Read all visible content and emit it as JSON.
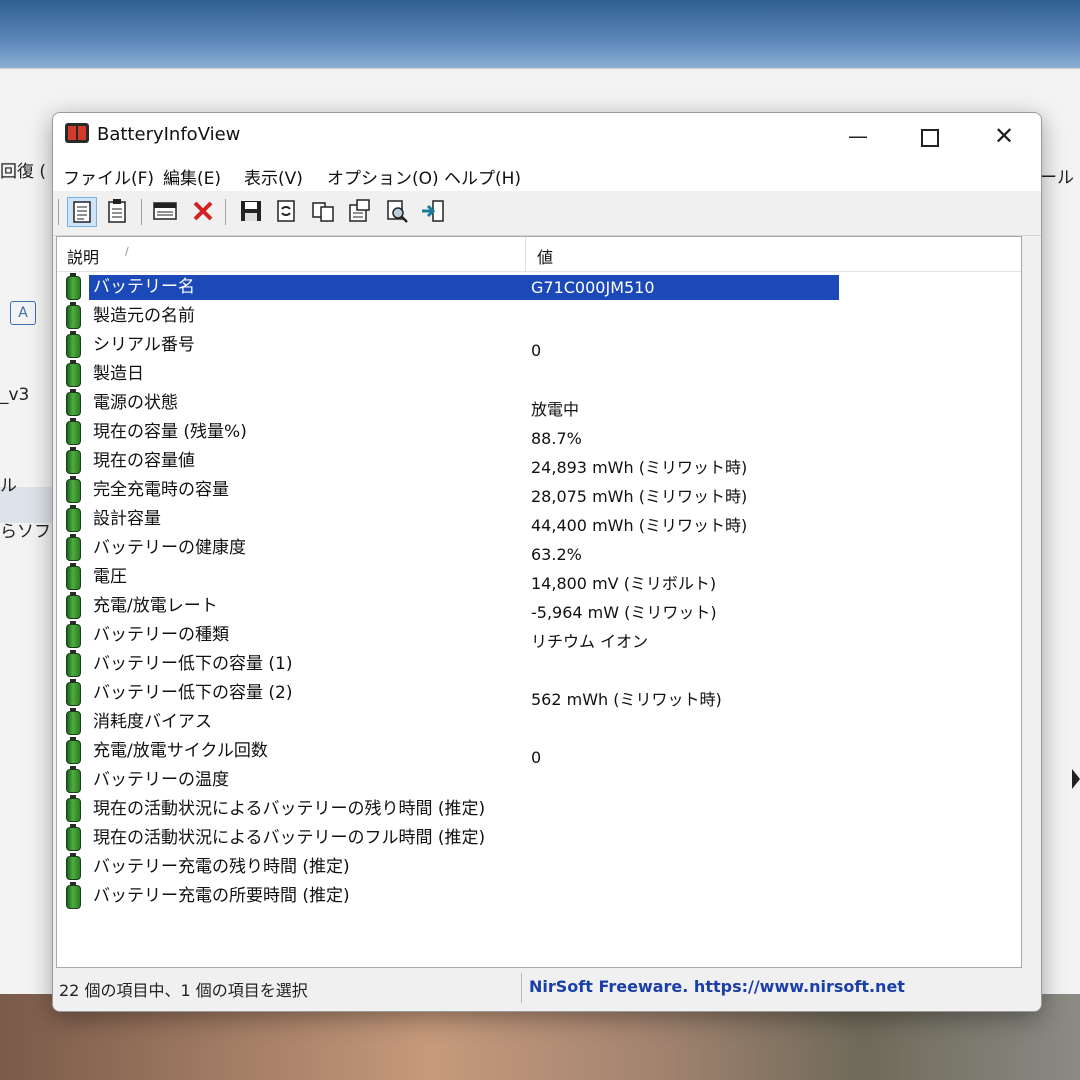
{
  "background_window": {
    "texts": [
      "回復 (",
      "_v3",
      "ル",
      "らソフト",
      "ール"
    ],
    "icon_label": "A"
  },
  "window": {
    "title": "BatteryInfoView",
    "minimize": "—",
    "close": "✕"
  },
  "menu": [
    "ファイル(F)",
    "編集(E)",
    "表示(V)",
    "オプション(O)",
    "ヘルプ(H)"
  ],
  "toolbar_icons": [
    "report-icon",
    "properties-icon",
    "window-icon",
    "delete-icon",
    "save-icon",
    "refresh-icon",
    "copy-icon",
    "options-icon",
    "find-icon",
    "exit-icon"
  ],
  "columns": {
    "name": "説明",
    "value": "値",
    "sort_indicator": "/"
  },
  "rows": [
    {
      "name": "バッテリー名",
      "value": "G71C000JM510",
      "selected": true
    },
    {
      "name": "製造元の名前",
      "value": ""
    },
    {
      "name": "シリアル番号",
      "value": "0"
    },
    {
      "name": "製造日",
      "value": ""
    },
    {
      "name": "電源の状態",
      "value": "放電中"
    },
    {
      "name": "現在の容量 (残量%)",
      "value": "88.7%"
    },
    {
      "name": "現在の容量値",
      "value": "24,893 mWh (ミリワット時)"
    },
    {
      "name": "完全充電時の容量",
      "value": "28,075 mWh (ミリワット時)"
    },
    {
      "name": "設計容量",
      "value": "44,400 mWh (ミリワット時)"
    },
    {
      "name": "バッテリーの健康度",
      "value": "63.2%"
    },
    {
      "name": "電圧",
      "value": "14,800 mV (ミリボルト)"
    },
    {
      "name": "充電/放電レート",
      "value": "-5,964 mW (ミリワット)"
    },
    {
      "name": "バッテリーの種類",
      "value": "リチウム イオン"
    },
    {
      "name": "バッテリー低下の容量 (1)",
      "value": ""
    },
    {
      "name": "バッテリー低下の容量 (2)",
      "value": "562 mWh (ミリワット時)"
    },
    {
      "name": "消耗度バイアス",
      "value": ""
    },
    {
      "name": "充電/放電サイクル回数",
      "value": "0"
    },
    {
      "name": "バッテリーの温度",
      "value": ""
    },
    {
      "name": "現在の活動状況によるバッテリーの残り時間 (推定)",
      "value": ""
    },
    {
      "name": "現在の活動状況によるバッテリーのフル時間 (推定)",
      "value": ""
    },
    {
      "name": "バッテリー充電の残り時間 (推定)",
      "value": ""
    },
    {
      "name": "バッテリー充電の所要時間 (推定)",
      "value": ""
    }
  ],
  "status": {
    "left": "22 個の項目中、1 個の項目を選択",
    "right": "NirSoft Freeware. https://www.nirsoft.net"
  },
  "colors": {
    "selection": "#1c49b8",
    "link": "#1b3fa8"
  }
}
